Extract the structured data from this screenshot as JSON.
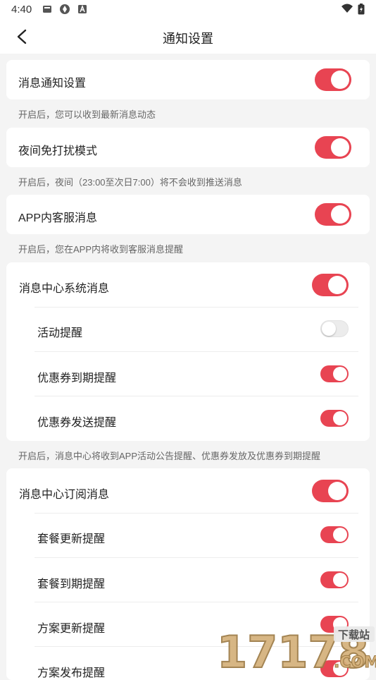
{
  "status_bar": {
    "time": "4:40"
  },
  "header": {
    "title": "通知设置"
  },
  "sections": {
    "message_notify": {
      "label": "消息通知设置",
      "caption": "开启后，您可以收到最新消息动态",
      "enabled": true
    },
    "night_mode": {
      "label": "夜间免打扰模式",
      "caption": "开启后，夜间（23:00至次日7:00）将不会收到推送消息",
      "enabled": true
    },
    "in_app_service": {
      "label": "APP内客服消息",
      "caption": "开启后，您在APP内将收到客服消息提醒",
      "enabled": true
    },
    "system_messages": {
      "label": "消息中心系统消息",
      "enabled": true,
      "caption": "开启后，消息中心将收到APP活动公告提醒、优惠券发放及优惠券到期提醒",
      "items": [
        {
          "label": "活动提醒",
          "enabled": false
        },
        {
          "label": "优惠券到期提醒",
          "enabled": true
        },
        {
          "label": "优惠券发送提醒",
          "enabled": true
        }
      ]
    },
    "subscription_messages": {
      "label": "消息中心订阅消息",
      "enabled": true,
      "items": [
        {
          "label": "套餐更新提醒",
          "enabled": true
        },
        {
          "label": "套餐到期提醒",
          "enabled": true
        },
        {
          "label": "方案更新提醒",
          "enabled": true
        },
        {
          "label": "方案发布提醒",
          "enabled": true
        }
      ]
    }
  },
  "watermark": {
    "text": "17178",
    "badge": "下载站",
    "suffix": ".COM"
  },
  "colors": {
    "accent": "#e84452",
    "toggle_off": "#ececec",
    "background": "#f4f4f4"
  }
}
